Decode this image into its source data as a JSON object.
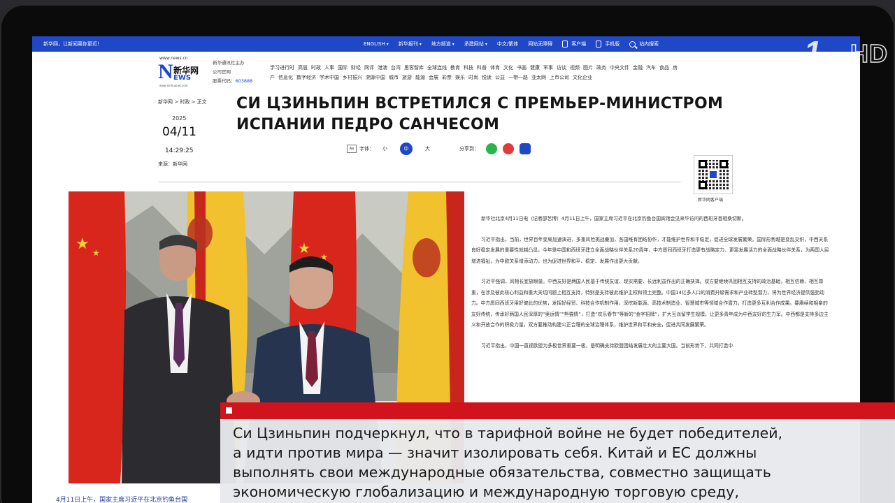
{
  "topnav": {
    "welcome": "新华网，让新闻离你更近！",
    "links": [
      "ENGLISH",
      "新华报刊",
      "地方频道",
      "承建网站",
      "中文/繁体",
      "网站无障碍",
      "客户端",
      "手机版",
      "站内搜索"
    ]
  },
  "header": {
    "logo_url": "www.news.cn",
    "logo_n": "N",
    "logo_cn": "新华网",
    "logo_ews": "EWS",
    "logo_sub": "www.xinhuanet.com",
    "org_line1": "新华通讯社主办",
    "org_line2": "公司官网",
    "org_code_label": "股票代码：",
    "org_code": "603888",
    "categories": [
      "学习进行时",
      "高层",
      "时政",
      "人事",
      "国际",
      "财经",
      "网评",
      "港澳",
      "台湾",
      "思客智库",
      "全球连线",
      "教育",
      "科技",
      "科普",
      "体育",
      "文化",
      "书画",
      "健康",
      "军事",
      "访谈",
      "视频",
      "图片",
      "政务",
      "中央文件",
      "金融",
      "汽车",
      "食品",
      "房产",
      "信息化",
      "数字经济",
      "学术中国",
      "乡村振兴",
      "溯源中国",
      "城市",
      "旅游",
      "能源",
      "会展",
      "彩票",
      "娱乐",
      "时尚",
      "悦读",
      "公益",
      "一带一路",
      "亚太网",
      "上市公司",
      "文化企业"
    ]
  },
  "article": {
    "breadcrumb": "新华网 > 时政 > 正文",
    "year": "2025",
    "day": "04/11",
    "time": "14:29:25",
    "source": "来源：新华网",
    "headline_line1": "СИ ЦЗИНЬПИН ВСТРЕТИЛСЯ С ПРЕМЬЕР-МИНИСТРОМ",
    "headline_line2": "ИСПАНИИ ПЕДРО САНЧЕСОМ",
    "font_label": "字体：",
    "font_small": "小",
    "font_medium": "中",
    "font_large": "大",
    "share_label": "分享到：",
    "qr_label": "新华网客户端",
    "paragraphs": [
      "新华社北京4月11日电（记者邵艺博）4月11日上午，国家主席习近平在北京钓鱼台国宾馆会见来华访问的西班牙首相桑切斯。",
      "习近平指出，当前，世界百年变局加速演进，多重风险挑战叠加，各国唯有团结协作，才能维护世界和平稳定，促进全球发展繁荣。国际形势越是变乱交织，中西关系良好稳定发展的重要性就越凸显。今年是中国和西班牙建立全面战略伙伴关系20周年，中方愿同西班牙打造更有战略定力、更富发展活力的全面战略伙伴关系，为两国人民增进福祉，为中欧关系增添动力，也为促进世界和平、稳定、发展作出更大贡献。",
      "习近平强调，风物长宜放眼量。中西友好是两国人民基于传统友谊、现实需要、长远利益作出的正确抉择。双方要继续巩固相互支持的政治基础，相互信赖、相互尊重，在涉及彼此核心利益和重大关切问题上相互支持，特别是支持彼此维护主权和领土完整。中国14亿多人口的消费升级需求和产业转型潜力，将为世界经济提供强劲动力。中方愿同西班牙用好彼此的优势，发挥好经贸、科技合作机制作用，深挖新能源、高技术制造业、智慧城市等领域合作潜力，打造更多互利合作成果。要赓续和相亲的友好传统，传承好两国人民深厚的“奥运情”“熊猫情”，打造“欢乐春节”等新的“金字招牌”，扩大互派留学生规模，让更多青年成为中西友好的生力军。中西都是支持多边主义和开放合作的积极力量，双方要推动构建公正合理的全球治理体系，维护世界和平和安全，促进共同发展繁荣。",
      "习近平指出，中国一直视欧盟为多极世界重要一极，是明确支持欧盟团结发展壮大的主要大国。当前形势下，共同打造中"
    ],
    "caption": "4月11日上午，国家主席习近平在北京钓鱼台国"
  },
  "channel_logo": {
    "one": "1",
    "hd": "HD"
  },
  "lower_third": {
    "lines": [
      "Си Цзиньпин подчеркнул, что в тарифной войне не будет победителей,",
      "а идти против мира — значит изолировать себя. Китай и ЕС должны",
      "выполнять свои международные обязательства, совместно защищать",
      "экономическую глобализацию и международную торговую среду,"
    ]
  },
  "colors": {
    "nav_blue": "#1f47c6",
    "lower_third_red": "#d0131d",
    "flag_red": "#d9261c",
    "flag_yellow": "#f2c12e"
  }
}
